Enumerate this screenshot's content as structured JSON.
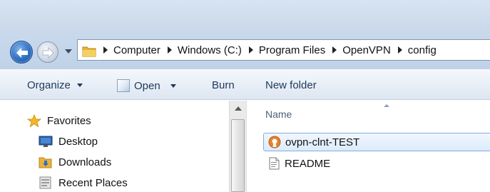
{
  "navigation": {
    "back_icon": "back-arrow-icon",
    "forward_icon": "forward-arrow-icon",
    "history_icon": "chevron-down-icon"
  },
  "address_bar": {
    "crumbs": [
      "Computer",
      "Windows (C:)",
      "Program Files",
      "OpenVPN",
      "config"
    ]
  },
  "command_bar": {
    "organize_label": "Organize",
    "open_label": "Open",
    "burn_label": "Burn",
    "new_folder_label": "New folder"
  },
  "nav_pane": {
    "favorites_label": "Favorites",
    "items": [
      {
        "label": "Desktop",
        "icon": "desktop-icon"
      },
      {
        "label": "Downloads",
        "icon": "downloads-folder-icon"
      },
      {
        "label": "Recent Places",
        "icon": "recent-places-icon"
      }
    ]
  },
  "content": {
    "column_name": "Name",
    "files": [
      {
        "name": "ovpn-clnt-TEST",
        "icon": "openvpn-config-icon",
        "selected": true
      },
      {
        "name": "README",
        "icon": "text-document-icon",
        "selected": false
      }
    ]
  },
  "colors": {
    "accent": "#2e6fc4",
    "selection": "#dcebfc",
    "command_text": "#1e395b",
    "openvpn_orange": "#e8822a"
  }
}
